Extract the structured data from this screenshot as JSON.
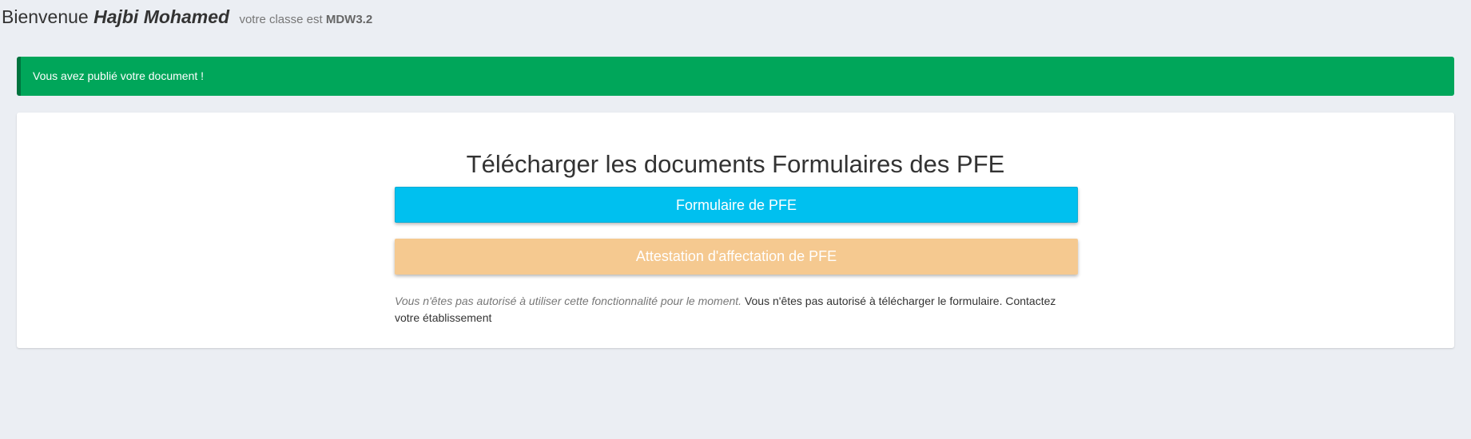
{
  "header": {
    "greeting": "Bienvenue",
    "user_name": "Hajbi Mohamed",
    "class_prefix": "votre classe est",
    "class_name": "MDW3.2"
  },
  "alert": {
    "message": "Vous avez publié votre document !",
    "color": "#00a65a"
  },
  "main": {
    "title": "Télécharger les documents Formulaires des PFE",
    "buttons": [
      {
        "label": "Formulaire de PFE",
        "color": "#00c0ef"
      },
      {
        "label": "Attestation d'affectation de PFE",
        "color": "#f5c990"
      }
    ],
    "note_italic": "Vous n'êtes pas autorisé à utiliser cette fonctionnalité pour le moment.",
    "note_text": "Vous n'êtes pas autorisé à télécharger le formulaire. Contactez votre établissement"
  }
}
